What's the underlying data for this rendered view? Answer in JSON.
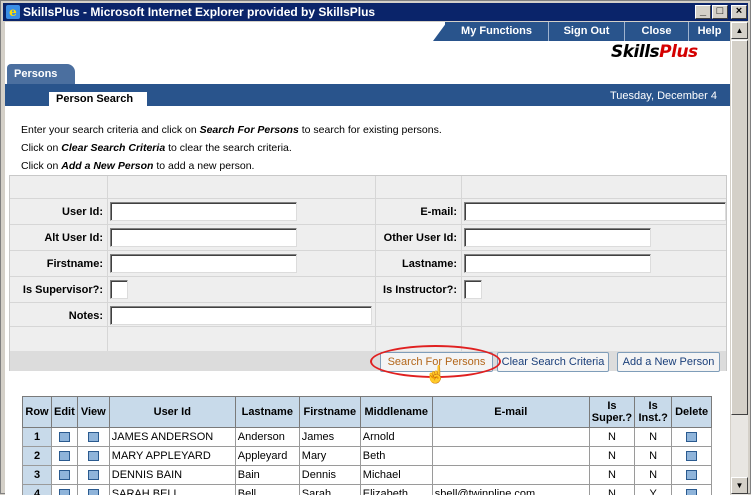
{
  "window": {
    "title": "SkillsPlus - Microsoft Internet Explorer provided by SkillsPlus"
  },
  "nav": {
    "my_functions": "My Functions",
    "sign_out": "Sign Out",
    "close": "Close",
    "help": "Help"
  },
  "logo": {
    "part1": "Skills",
    "part2": "Plus"
  },
  "tabs": {
    "main": "Persons",
    "sub": "Person Search"
  },
  "date": "Tuesday, December 4",
  "instructions": {
    "line1_pre": "Enter your search criteria and click on ",
    "line1_em": "Search For Persons",
    "line1_post": " to search for existing persons.",
    "line2_pre": "Click on ",
    "line2_em": "Clear Search Criteria",
    "line2_post": " to clear the search criteria.",
    "line3_pre": "Click on ",
    "line3_em": "Add a New Person",
    "line3_post": " to add a new person."
  },
  "form": {
    "user_id": "User Id:",
    "alt_user_id": "Alt User Id:",
    "firstname": "Firstname:",
    "is_supervisor": "Is Supervisor?:",
    "notes": "Notes:",
    "email": "E-mail:",
    "other_user_id": "Other User Id:",
    "lastname": "Lastname:",
    "is_instructor": "Is Instructor?:"
  },
  "buttons": {
    "search": "Search For Persons",
    "clear": "Clear Search Criteria",
    "add": "Add a New Person"
  },
  "table": {
    "headers": {
      "row": "Row",
      "edit": "Edit",
      "view": "View",
      "user_id": "User Id",
      "lastname": "Lastname",
      "firstname": "Firstname",
      "middlename": "Middlename",
      "email": "E-mail",
      "is_super_1": "Is",
      "is_super_2": "Super.?",
      "is_inst_1": "Is",
      "is_inst_2": "Inst.?",
      "delete": "Delete"
    },
    "rows": [
      {
        "row": "1",
        "user_id": "JAMES ANDERSON",
        "lastname": "Anderson",
        "firstname": "James",
        "middlename": "Arnold",
        "email": "",
        "super": "N",
        "inst": "N"
      },
      {
        "row": "2",
        "user_id": "MARY APPLEYARD",
        "lastname": "Appleyard",
        "firstname": "Mary",
        "middlename": "Beth",
        "email": "",
        "super": "N",
        "inst": "N"
      },
      {
        "row": "3",
        "user_id": "DENNIS BAIN",
        "lastname": "Bain",
        "firstname": "Dennis",
        "middlename": "Michael",
        "email": "",
        "super": "N",
        "inst": "N"
      },
      {
        "row": "4",
        "user_id": "SARAH BELL",
        "lastname": "Bell",
        "firstname": "Sarah",
        "middlename": "Elizabeth",
        "email": "sbell@twinpline.com",
        "super": "N",
        "inst": "Y"
      }
    ]
  }
}
